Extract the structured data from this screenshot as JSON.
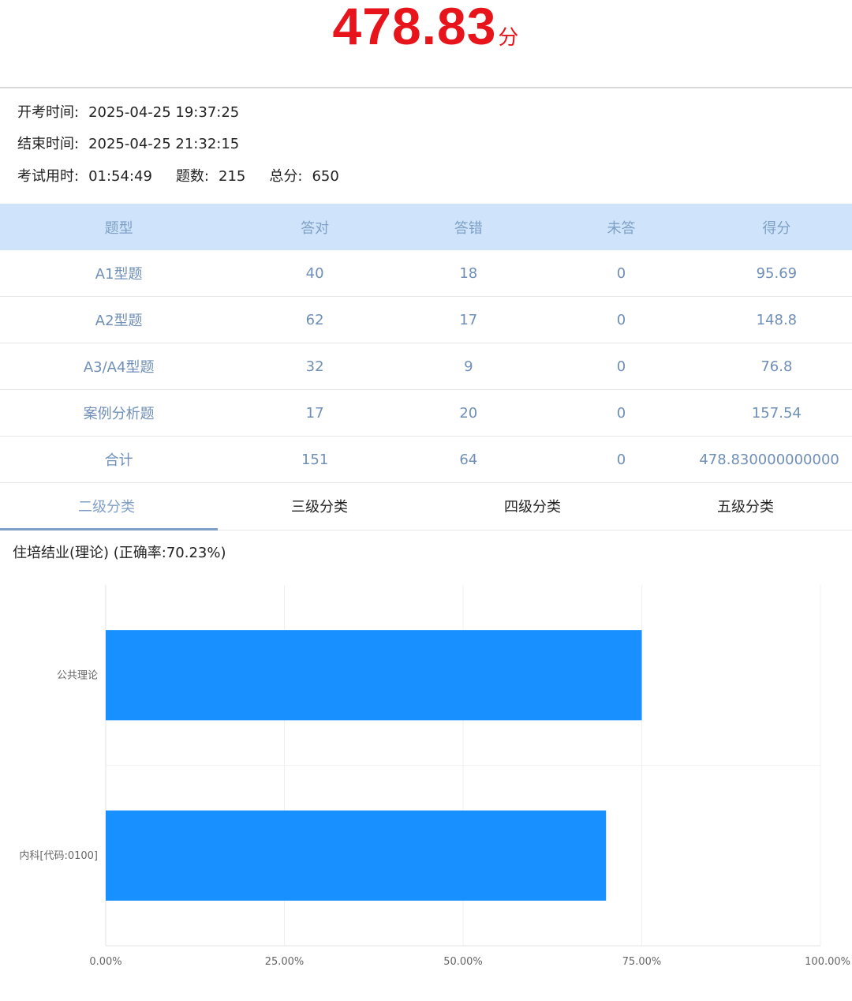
{
  "score": {
    "value": "478.83",
    "unit": "分",
    "color": "#e8141b"
  },
  "exam_info": {
    "start_label": "开考时间:",
    "start_value": "2025-04-25 19:37:25",
    "end_label": "结束时间:",
    "end_value": "2025-04-25 21:32:15",
    "duration_label": "考试用时:",
    "duration_value": "01:54:49",
    "count_label": "题数:",
    "count_value": "215",
    "total_label": "总分:",
    "total_value": "650"
  },
  "table": {
    "headers": [
      "题型",
      "答对",
      "答错",
      "未答",
      "得分"
    ],
    "rows": [
      [
        "A1型题",
        "40",
        "18",
        "0",
        "95.69"
      ],
      [
        "A2型题",
        "62",
        "17",
        "0",
        "148.8"
      ],
      [
        "A3/A4型题",
        "32",
        "9",
        "0",
        "76.8"
      ],
      [
        "案例分析题",
        "17",
        "20",
        "0",
        "157.54"
      ],
      [
        "合计",
        "151",
        "64",
        "0",
        "478.830000000000"
      ]
    ],
    "header_bg": "#cfe4fa",
    "text_color": "#6f8fb8"
  },
  "tabs": [
    {
      "label": "二级分类",
      "active": true
    },
    {
      "label": "三级分类",
      "active": false
    },
    {
      "label": "四级分类",
      "active": false
    },
    {
      "label": "五级分类",
      "active": false
    }
  ],
  "section": {
    "title": "住培结业(理论) (正确率:70.23%)"
  },
  "chart_data": {
    "type": "bar",
    "orientation": "horizontal",
    "categories": [
      "公共理论",
      "内科[代码:0100]"
    ],
    "values": [
      75,
      70
    ],
    "xlim": [
      0,
      100
    ],
    "xticks": [
      "0.00%",
      "25.00%",
      "50.00%",
      "75.00%",
      "100.00%"
    ],
    "grid": true,
    "bar_color": "#1890ff"
  }
}
